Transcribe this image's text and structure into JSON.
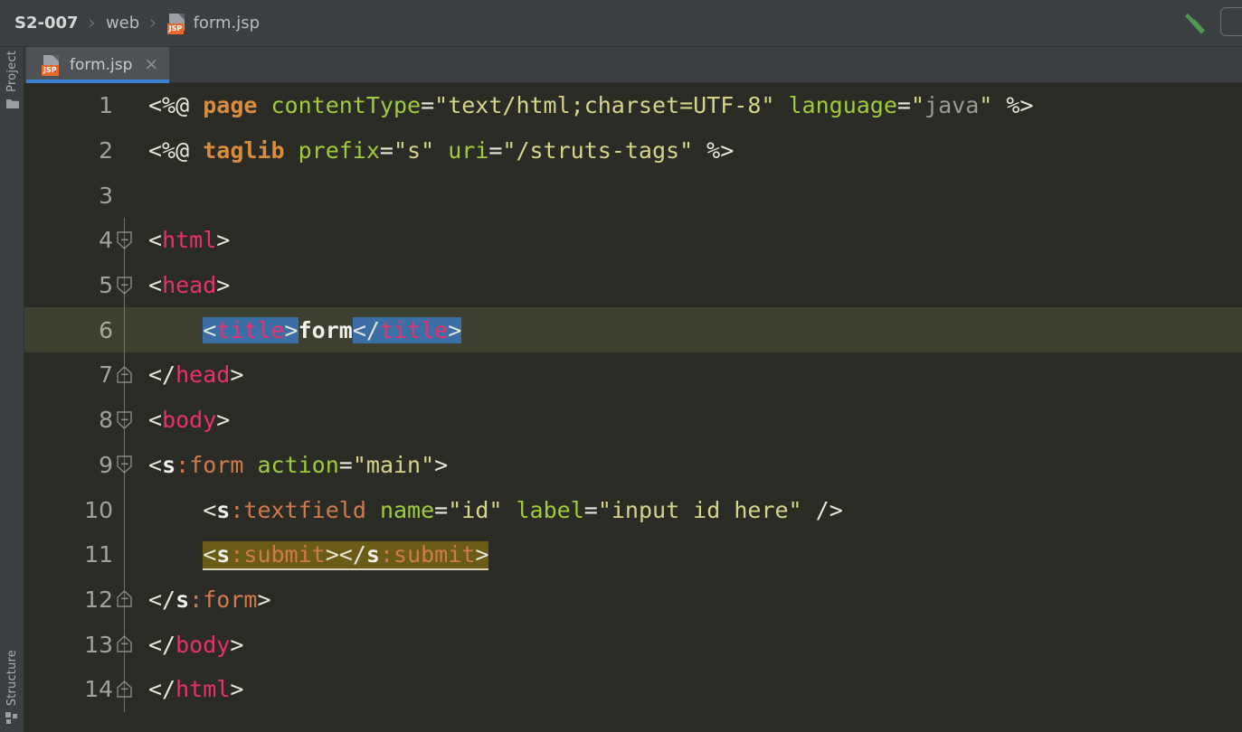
{
  "window": {
    "app": "IDE Editor",
    "bg_editor": "#2b2b26",
    "bg_chrome": "#3c3f41",
    "accent": "#3d7fd1"
  },
  "breadcrumb": {
    "items": [
      {
        "label": "S2-007",
        "icon": "",
        "bold": true
      },
      {
        "label": "web",
        "icon": "",
        "bold": false
      },
      {
        "label": "form.jsp",
        "icon": "jsp-file-icon",
        "bold": false
      }
    ],
    "separator": "›"
  },
  "toolbar": {
    "build_icon": "hammer-icon",
    "run_config_selector": ""
  },
  "left_tool_window": {
    "top": {
      "label": "Project",
      "icon": "folder-icon"
    },
    "bottom": {
      "label": "Structure",
      "icon": "structure-icon"
    }
  },
  "tabs": [
    {
      "label": "form.jsp",
      "icon": "jsp-file-icon",
      "close": "×",
      "active": true
    }
  ],
  "editor": {
    "file": "form.jsp",
    "language": "JSP",
    "current_line": 6,
    "line_numbers": [
      "1",
      "2",
      "3",
      "4",
      "5",
      "6",
      "7",
      "8",
      "9",
      "10",
      "11",
      "12",
      "13",
      "14"
    ],
    "lines": [
      {
        "n": "1",
        "fold": "none",
        "text": "<%@ page contentType=\"text/html;charset=UTF-8\" language=\"java\" %>"
      },
      {
        "n": "2",
        "fold": "none",
        "text": "<%@ taglib prefix=\"s\" uri=\"/struts-tags\" %>"
      },
      {
        "n": "3",
        "fold": "none",
        "text": ""
      },
      {
        "n": "4",
        "fold": "open",
        "text": "<html>"
      },
      {
        "n": "5",
        "fold": "open",
        "text": "<head>"
      },
      {
        "n": "6",
        "fold": "none",
        "text": "    <title>form</title>"
      },
      {
        "n": "7",
        "fold": "close",
        "text": "</head>"
      },
      {
        "n": "8",
        "fold": "open",
        "text": "<body>"
      },
      {
        "n": "9",
        "fold": "open",
        "text": "<s:form action=\"main\">"
      },
      {
        "n": "10",
        "fold": "none",
        "text": "    <s:textfield name=\"id\" label=\"input id here\" />"
      },
      {
        "n": "11",
        "fold": "none",
        "text": "    <s:submit></s:submit>"
      },
      {
        "n": "12",
        "fold": "close",
        "text": "</s:form>"
      },
      {
        "n": "13",
        "fold": "close",
        "text": "</body>"
      },
      {
        "n": "14",
        "fold": "close",
        "text": "</html>"
      }
    ],
    "tokens": {
      "l1": [
        {
          "t": "<%@ ",
          "c": "t-dir"
        },
        {
          "t": "page",
          "c": "t-dirname"
        },
        {
          "t": " ",
          "c": "t-dir"
        },
        {
          "t": "contentType",
          "c": "t-attr"
        },
        {
          "t": "=",
          "c": "t-eq"
        },
        {
          "t": "\"text/html;charset=UTF-8\"",
          "c": "t-str"
        },
        {
          "t": " ",
          "c": "t-dir"
        },
        {
          "t": "language",
          "c": "t-attr"
        },
        {
          "t": "=",
          "c": "t-eq"
        },
        {
          "t": "\"",
          "c": "t-str"
        },
        {
          "t": "java",
          "c": "t-strgray"
        },
        {
          "t": "\"",
          "c": "t-str"
        },
        {
          "t": " %>",
          "c": "t-dir"
        }
      ],
      "l2": [
        {
          "t": "<%@ ",
          "c": "t-dir"
        },
        {
          "t": "taglib",
          "c": "t-dirname"
        },
        {
          "t": " ",
          "c": "t-dir"
        },
        {
          "t": "prefix",
          "c": "t-attr"
        },
        {
          "t": "=",
          "c": "t-eq"
        },
        {
          "t": "\"s\"",
          "c": "t-str"
        },
        {
          "t": " ",
          "c": "t-dir"
        },
        {
          "t": "uri",
          "c": "t-attr"
        },
        {
          "t": "=",
          "c": "t-eq"
        },
        {
          "t": "\"/struts-tags\"",
          "c": "t-str"
        },
        {
          "t": " %>",
          "c": "t-dir"
        }
      ],
      "l4": [
        {
          "t": "<",
          "c": "t-brack"
        },
        {
          "t": "html",
          "c": "t-tag"
        },
        {
          "t": ">",
          "c": "t-brack"
        }
      ],
      "l5": [
        {
          "t": "<",
          "c": "t-brack"
        },
        {
          "t": "head",
          "c": "t-tag"
        },
        {
          "t": ">",
          "c": "t-brack"
        }
      ],
      "l6": [
        {
          "t": "    ",
          "c": "t-brack"
        },
        {
          "t": "<",
          "c": "t-brack sel"
        },
        {
          "t": "title",
          "c": "t-tag sel"
        },
        {
          "t": ">",
          "c": "t-brack sel"
        },
        {
          "t": "form",
          "c": "t-text"
        },
        {
          "t": "</",
          "c": "t-brack sel"
        },
        {
          "t": "title",
          "c": "t-tag sel"
        },
        {
          "t": ">",
          "c": "t-brack sel"
        }
      ],
      "l7": [
        {
          "t": "</",
          "c": "t-brack"
        },
        {
          "t": "head",
          "c": "t-tag"
        },
        {
          "t": ">",
          "c": "t-brack"
        }
      ],
      "l8": [
        {
          "t": "<",
          "c": "t-brack"
        },
        {
          "t": "body",
          "c": "t-tag"
        },
        {
          "t": ">",
          "c": "t-brack"
        }
      ],
      "l9": [
        {
          "t": "<",
          "c": "t-brack"
        },
        {
          "t": "s",
          "c": "t-sprefix"
        },
        {
          "t": ":",
          "c": "t-stag"
        },
        {
          "t": "form",
          "c": "t-stag"
        },
        {
          "t": " ",
          "c": "t-brack"
        },
        {
          "t": "action",
          "c": "t-attr"
        },
        {
          "t": "=",
          "c": "t-eq"
        },
        {
          "t": "\"main\"",
          "c": "t-str"
        },
        {
          "t": ">",
          "c": "t-brack"
        }
      ],
      "l10": [
        {
          "t": "    ",
          "c": "t-brack"
        },
        {
          "t": "<",
          "c": "t-brack"
        },
        {
          "t": "s",
          "c": "t-sprefix"
        },
        {
          "t": ":",
          "c": "t-stag"
        },
        {
          "t": "textfield",
          "c": "t-stag"
        },
        {
          "t": " ",
          "c": "t-brack"
        },
        {
          "t": "name",
          "c": "t-attr"
        },
        {
          "t": "=",
          "c": "t-eq"
        },
        {
          "t": "\"id\"",
          "c": "t-str"
        },
        {
          "t": " ",
          "c": "t-brack"
        },
        {
          "t": "label",
          "c": "t-attr"
        },
        {
          "t": "=",
          "c": "t-eq"
        },
        {
          "t": "\"input id here\"",
          "c": "t-str"
        },
        {
          "t": " />",
          "c": "t-brack"
        }
      ],
      "l11pre": "    ",
      "l11": [
        {
          "t": "<",
          "c": "t-brack"
        },
        {
          "t": "s",
          "c": "t-sprefix"
        },
        {
          "t": ":",
          "c": "t-stag"
        },
        {
          "t": "submit",
          "c": "t-stag"
        },
        {
          "t": ">",
          "c": "t-brack"
        },
        {
          "t": "</",
          "c": "t-brack"
        },
        {
          "t": "s",
          "c": "t-sprefix"
        },
        {
          "t": ":",
          "c": "t-stag"
        },
        {
          "t": "submit",
          "c": "t-stag"
        },
        {
          "t": ">",
          "c": "t-brack"
        }
      ],
      "l12": [
        {
          "t": "</",
          "c": "t-brack"
        },
        {
          "t": "s",
          "c": "t-sprefix"
        },
        {
          "t": ":",
          "c": "t-stag"
        },
        {
          "t": "form",
          "c": "t-stag"
        },
        {
          "t": ">",
          "c": "t-brack"
        }
      ],
      "l13": [
        {
          "t": "</",
          "c": "t-brack"
        },
        {
          "t": "body",
          "c": "t-tag"
        },
        {
          "t": ">",
          "c": "t-brack"
        }
      ],
      "l14": [
        {
          "t": "</",
          "c": "t-brack"
        },
        {
          "t": "html",
          "c": "t-tag"
        },
        {
          "t": ">",
          "c": "t-brack"
        }
      ]
    },
    "highlights": {
      "selection_color": "#3b6ea5",
      "warning_color": "#6a5c17",
      "current_line_color": "#3d4030"
    }
  }
}
